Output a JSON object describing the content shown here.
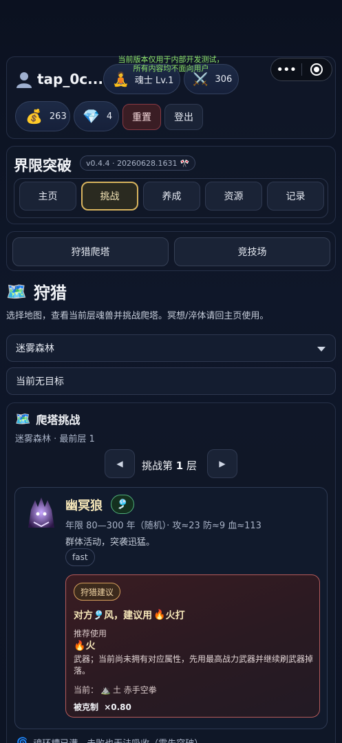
{
  "notice": {
    "line1": "当前版本仅用于内部开发测试，",
    "line2": "所有内容均不面向用户"
  },
  "header": {
    "username": "tap_0c...",
    "realm": "魂士 Lv.1",
    "power": "306",
    "coins": "263",
    "gems": "4",
    "reset_label": "重置",
    "logout_label": "登出"
  },
  "brand": {
    "title": "界限突破",
    "version": "v0.4.4 · 20260628.1631"
  },
  "tabs": [
    "主页",
    "挑战",
    "养成",
    "资源",
    "记录"
  ],
  "active_tab": "挑战",
  "mode_buttons": [
    "狩猎爬塔",
    "竞技场"
  ],
  "hunt": {
    "title": "狩猎",
    "description": "选择地图，查看当前层魂兽并挑战爬塔。冥想/淬体请回主页使用。",
    "map_selected": "迷雾森林",
    "target_text": "当前无目标"
  },
  "tower": {
    "title": "爬塔挑战",
    "subtitle": "迷雾森林 · 最前层 1",
    "challenge_prefix": "挑战第 ",
    "challenge_floor": "1",
    "challenge_suffix": " 层",
    "prev_icon": "◀",
    "next_icon": "▶"
  },
  "monster": {
    "name": "幽冥狼",
    "element_icon": "wind-flag-icon",
    "stats": "年限 80—300 年（随机）· 攻≈23 防≈9 血≈113",
    "desc": "群体活动，突袭迅猛。",
    "tag": "fast"
  },
  "advice": {
    "badge": "狩猎建议",
    "headline_prefix": "对方 ",
    "headline_enemy": "风，建议用 ",
    "headline_elem": "火",
    "headline_suffix": " 打",
    "recommend_label": "推荐使用",
    "recommend_elem": "火",
    "weapon_note": "武器；当前尚未拥有对应属性，先用最高战力武器并继续刷武器掉落。",
    "current_prefix": "当前：",
    "current_value": "土 赤手空拳",
    "counter_label": "被克制",
    "counter_value": "×0.80"
  },
  "footer_note": "魂环槽已满，击败也无法吸收（需先突破）",
  "colors": {
    "accent_gold": "#d9b55e",
    "advice_border": "#b65a5a",
    "notice_green": "#8ee66a"
  }
}
